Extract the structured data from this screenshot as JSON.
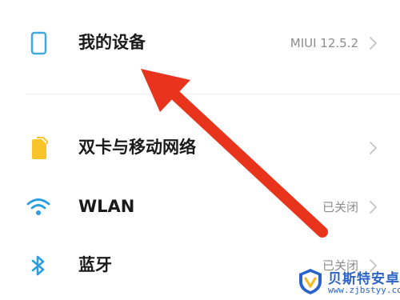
{
  "settings": {
    "items": [
      {
        "label": "我的设备",
        "value": "MIUI 12.5.2",
        "icon": "phone-outline-icon",
        "color": "#3fa9e0"
      },
      {
        "label": "双卡与移动网络",
        "value": "",
        "icon": "sim-card-icon",
        "color": "#f7c42a"
      },
      {
        "label": "WLAN",
        "value": "已关闭",
        "icon": "wifi-icon",
        "color": "#2b9fe0"
      },
      {
        "label": "蓝牙",
        "value": "已关闭",
        "icon": "bluetooth-icon",
        "color": "#2b9fe0"
      }
    ]
  },
  "annotation": {
    "arrow_color": "#e8341c"
  },
  "watermark": {
    "title": "贝斯特安卓网",
    "url": "www.zjbstyy.com",
    "brand_color": "#2a63c9"
  }
}
